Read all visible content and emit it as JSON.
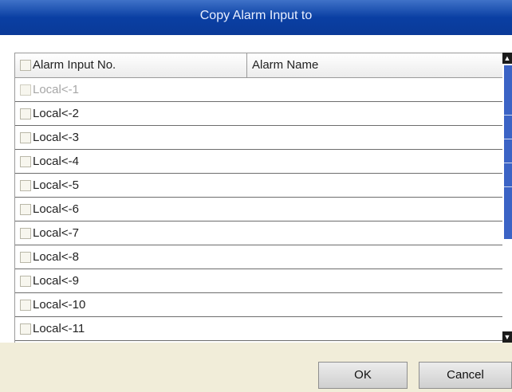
{
  "dialog": {
    "title": "Copy Alarm Input to",
    "columns": [
      "Alarm Input No.",
      "Alarm Name"
    ],
    "rows": [
      {
        "label": "Local<-1",
        "disabled": true
      },
      {
        "label": "Local<-2",
        "disabled": false
      },
      {
        "label": "Local<-3",
        "disabled": false
      },
      {
        "label": "Local<-4",
        "disabled": false
      },
      {
        "label": "Local<-5",
        "disabled": false
      },
      {
        "label": "Local<-6",
        "disabled": false
      },
      {
        "label": "Local<-7",
        "disabled": false
      },
      {
        "label": "Local<-8",
        "disabled": false
      },
      {
        "label": "Local<-9",
        "disabled": false
      },
      {
        "label": "Local<-10",
        "disabled": false
      },
      {
        "label": "Local<-11",
        "disabled": false
      }
    ],
    "buttons": {
      "ok": "OK",
      "cancel": "Cancel"
    },
    "icons": {
      "scroll_up": "chevron-up-icon",
      "scroll_down": "chevron-down-icon"
    },
    "colors": {
      "title_bar": "#0a3fa3",
      "scroll_thumb": "#3b63c5",
      "footer": "#f1edd9"
    }
  }
}
